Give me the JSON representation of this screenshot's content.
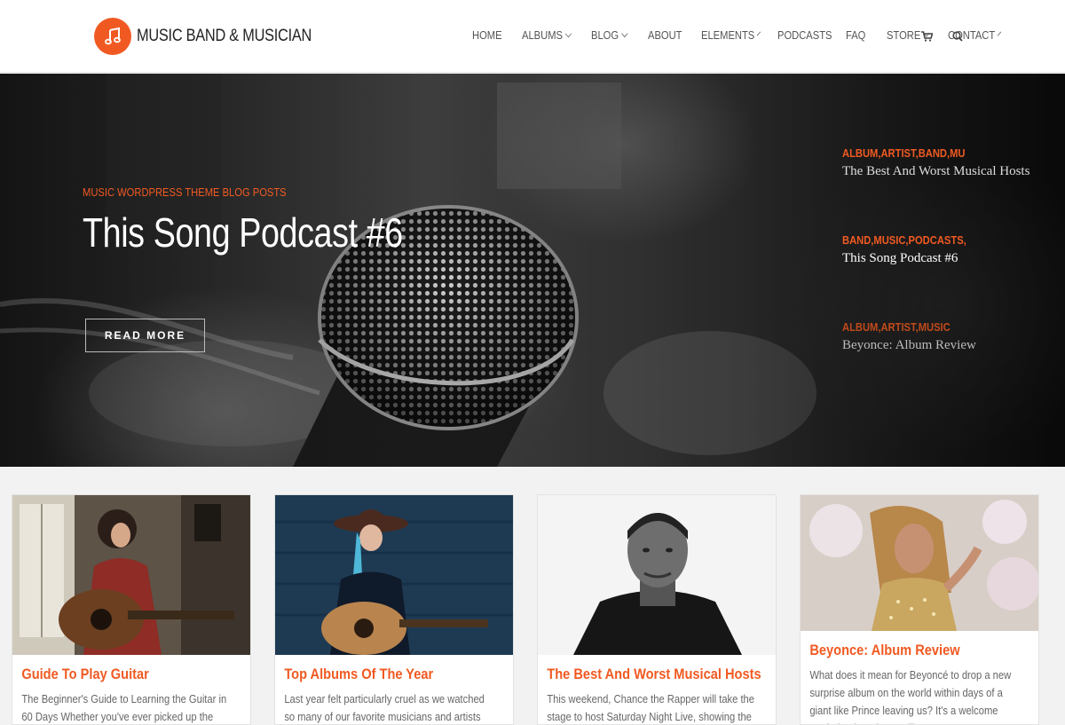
{
  "site": {
    "name": "MUSIC BAND & MUSICIAN",
    "logo_icon": "music-note-icon",
    "accent": "#f05a22"
  },
  "nav": {
    "items": [
      {
        "label": "HOME",
        "dropdown": false
      },
      {
        "label": "ALBUMS",
        "dropdown": true
      },
      {
        "label": "BLOG",
        "dropdown": true
      },
      {
        "label": "ABOUT",
        "dropdown": false
      },
      {
        "label": "ELEMENTS",
        "dropdown": true
      },
      {
        "label": "PODCASTS",
        "dropdown": false
      },
      {
        "label": "FAQ",
        "dropdown": false
      },
      {
        "label": "STORE",
        "dropdown": true
      },
      {
        "label": "CONTACT",
        "dropdown": true
      }
    ],
    "icons": [
      "cart-icon",
      "search-icon"
    ]
  },
  "hero": {
    "kicker": "MUSIC WORDPRESS THEME BLOG POSTS",
    "title": "This Song Podcast #6",
    "button": "READ MORE"
  },
  "side_posts": [
    {
      "categories": "ALBUM,ARTIST,BAND,MU",
      "title": "The Best And Worst Musical Hosts"
    },
    {
      "categories": "BAND,MUSIC,PODCASTS,",
      "title": "This Song Podcast #6"
    },
    {
      "categories": "ALBUM,ARTIST,MUSIC",
      "title": "Beyonce: Album Review"
    }
  ],
  "cards": [
    {
      "title": "Guide To Play Guitar",
      "excerpt": "The Beginner's Guide to Learning the Guitar in 60 Days Whether you've ever picked up the instrument",
      "image": "woman-playing-guitar-photo"
    },
    {
      "title": "Top Albums Of The Year",
      "excerpt": "Last year felt particularly cruel as we watched so many of our favorite musicians and artists leave",
      "image": "cowgirl-with-guitar-photo"
    },
    {
      "title": "The Best And Worst Musical Hosts",
      "excerpt": "This weekend, Chance the Rapper will take the stage to host Saturday Night Live, showing the music he's",
      "image": "man-portrait-photo"
    },
    {
      "title": "Beyonce: Album Review",
      "excerpt": "What does it mean for Beyoncé to drop a new surprise album on the world within days of a giant like Prince leaving us? It's a welcome reminder that giants still",
      "image": "singer-performing-photo"
    }
  ]
}
